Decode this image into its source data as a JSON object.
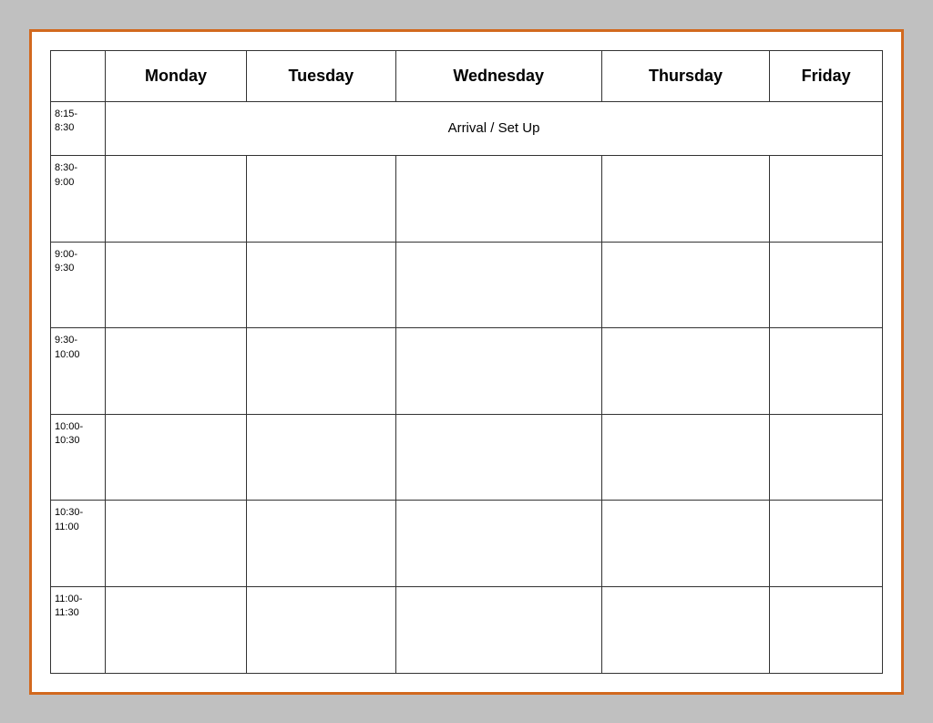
{
  "table": {
    "headers": {
      "time_col": "",
      "monday": "Monday",
      "tuesday": "Tuesday",
      "wednesday": "Wednesday",
      "thursday": "Thursday",
      "friday": "Friday"
    },
    "rows": [
      {
        "time": "8:15-\n8:30",
        "arrival_text": "Arrival / Set Up",
        "is_arrival": true
      },
      {
        "time": "8:30-\n9:00",
        "is_arrival": false
      },
      {
        "time": "9:00-\n9:30",
        "is_arrival": false
      },
      {
        "time": "9:30-\n10:00",
        "is_arrival": false
      },
      {
        "time": "10:00-\n10:30",
        "is_arrival": false
      },
      {
        "time": "10:30-\n11:00",
        "is_arrival": false
      },
      {
        "time": "11:00-\n11:30",
        "is_arrival": false
      }
    ]
  }
}
